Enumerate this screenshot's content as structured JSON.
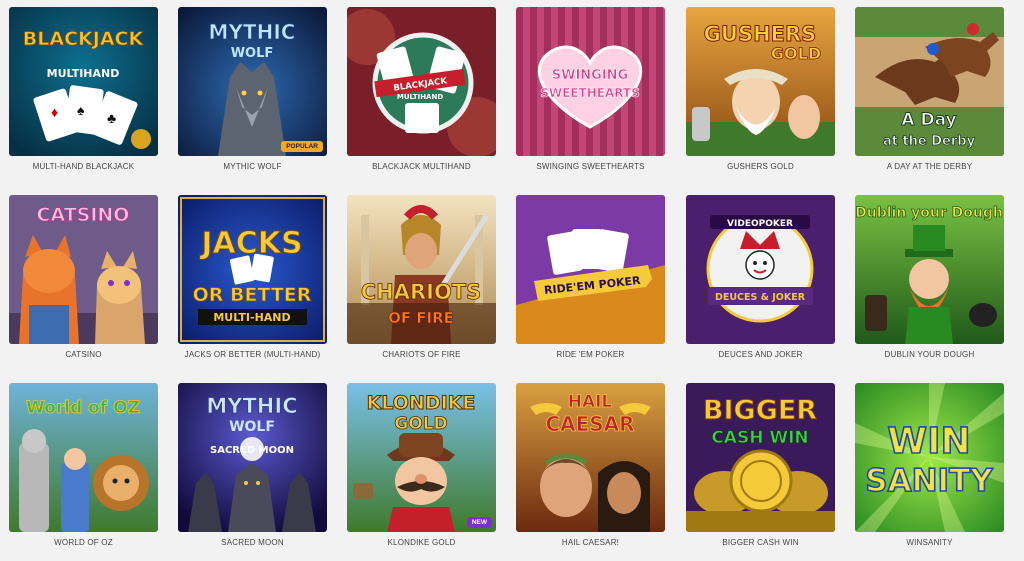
{
  "colors": {
    "page_bg": "#f2f2f2",
    "caption": "#444444",
    "popular": "#f5a623",
    "new": "#7b2fd0"
  },
  "games": [
    {
      "caption": "MULTI-HAND BLACKJACK",
      "title": "BLACKJACK",
      "subtitle": "MULTIHAND",
      "icon": "playing-cards-icon"
    },
    {
      "caption": "MYTHIC WOLF",
      "title": "MYTHIC",
      "subtitle": "WOLF",
      "badge": "POPULAR",
      "icon": "wolf-icon"
    },
    {
      "caption": "BLACKJACK MULTIHAND",
      "title": "BLACKJACK",
      "subtitle": "MULTIHAND",
      "icon": "playing-cards-icon"
    },
    {
      "caption": "SWINGING SWEETHEARTS",
      "title": "SWINGING",
      "subtitle": "SWEETHEARTS",
      "icon": "heart-icon"
    },
    {
      "caption": "GUSHERS GOLD",
      "title": "GUSHERS",
      "subtitle": "GOLD",
      "icon": "prospector-icon"
    },
    {
      "caption": "A DAY AT THE DERBY",
      "title": "A Day",
      "subtitle": "at the Derby",
      "icon": "racehorse-icon"
    },
    {
      "caption": "CATSINO",
      "title": "CATSINO",
      "icon": "cats-icon"
    },
    {
      "caption": "JACKS OR BETTER (MULTI-HAND)",
      "title": "JACKS",
      "subtitle": "OR BETTER",
      "tag": "MULTI-HAND",
      "icon": "playing-cards-icon"
    },
    {
      "caption": "CHARIOTS OF FIRE",
      "title": "CHARIOTS",
      "subtitle": "OF FIRE",
      "icon": "roman-soldier-icon"
    },
    {
      "caption": "RIDE 'EM POKER",
      "title": "RIDE'EM POKER",
      "icon": "playing-cards-icon"
    },
    {
      "caption": "DEUCES AND JOKER",
      "title": "VIDEOPOKER",
      "subtitle": "DEUCES & JOKER",
      "icon": "joker-icon"
    },
    {
      "caption": "DUBLIN YOUR DOUGH",
      "title": "Dublin your Dough",
      "icon": "leprechaun-icon"
    },
    {
      "caption": "WORLD OF OZ",
      "title": "World of OZ",
      "icon": "lion-icon"
    },
    {
      "caption": "SACRED MOON",
      "title": "MYTHIC",
      "subtitle": "WOLF",
      "tag": "SACRED MOON",
      "icon": "wolf-icon"
    },
    {
      "caption": "KLONDIKE GOLD",
      "title": "KLONDIKE",
      "subtitle": "GOLD",
      "badge": "NEW",
      "icon": "miner-icon"
    },
    {
      "caption": "HAIL CAESAR!",
      "title": "HAIL",
      "subtitle": "CAESAR",
      "icon": "caesar-icon"
    },
    {
      "caption": "BIGGER CASH WIN",
      "title": "BIGGER",
      "subtitle": "CASH WIN",
      "icon": "gold-coins-icon"
    },
    {
      "caption": "WINSANITY",
      "title": "WIN",
      "subtitle": "SANITY",
      "icon": "sunburst-icon"
    }
  ]
}
